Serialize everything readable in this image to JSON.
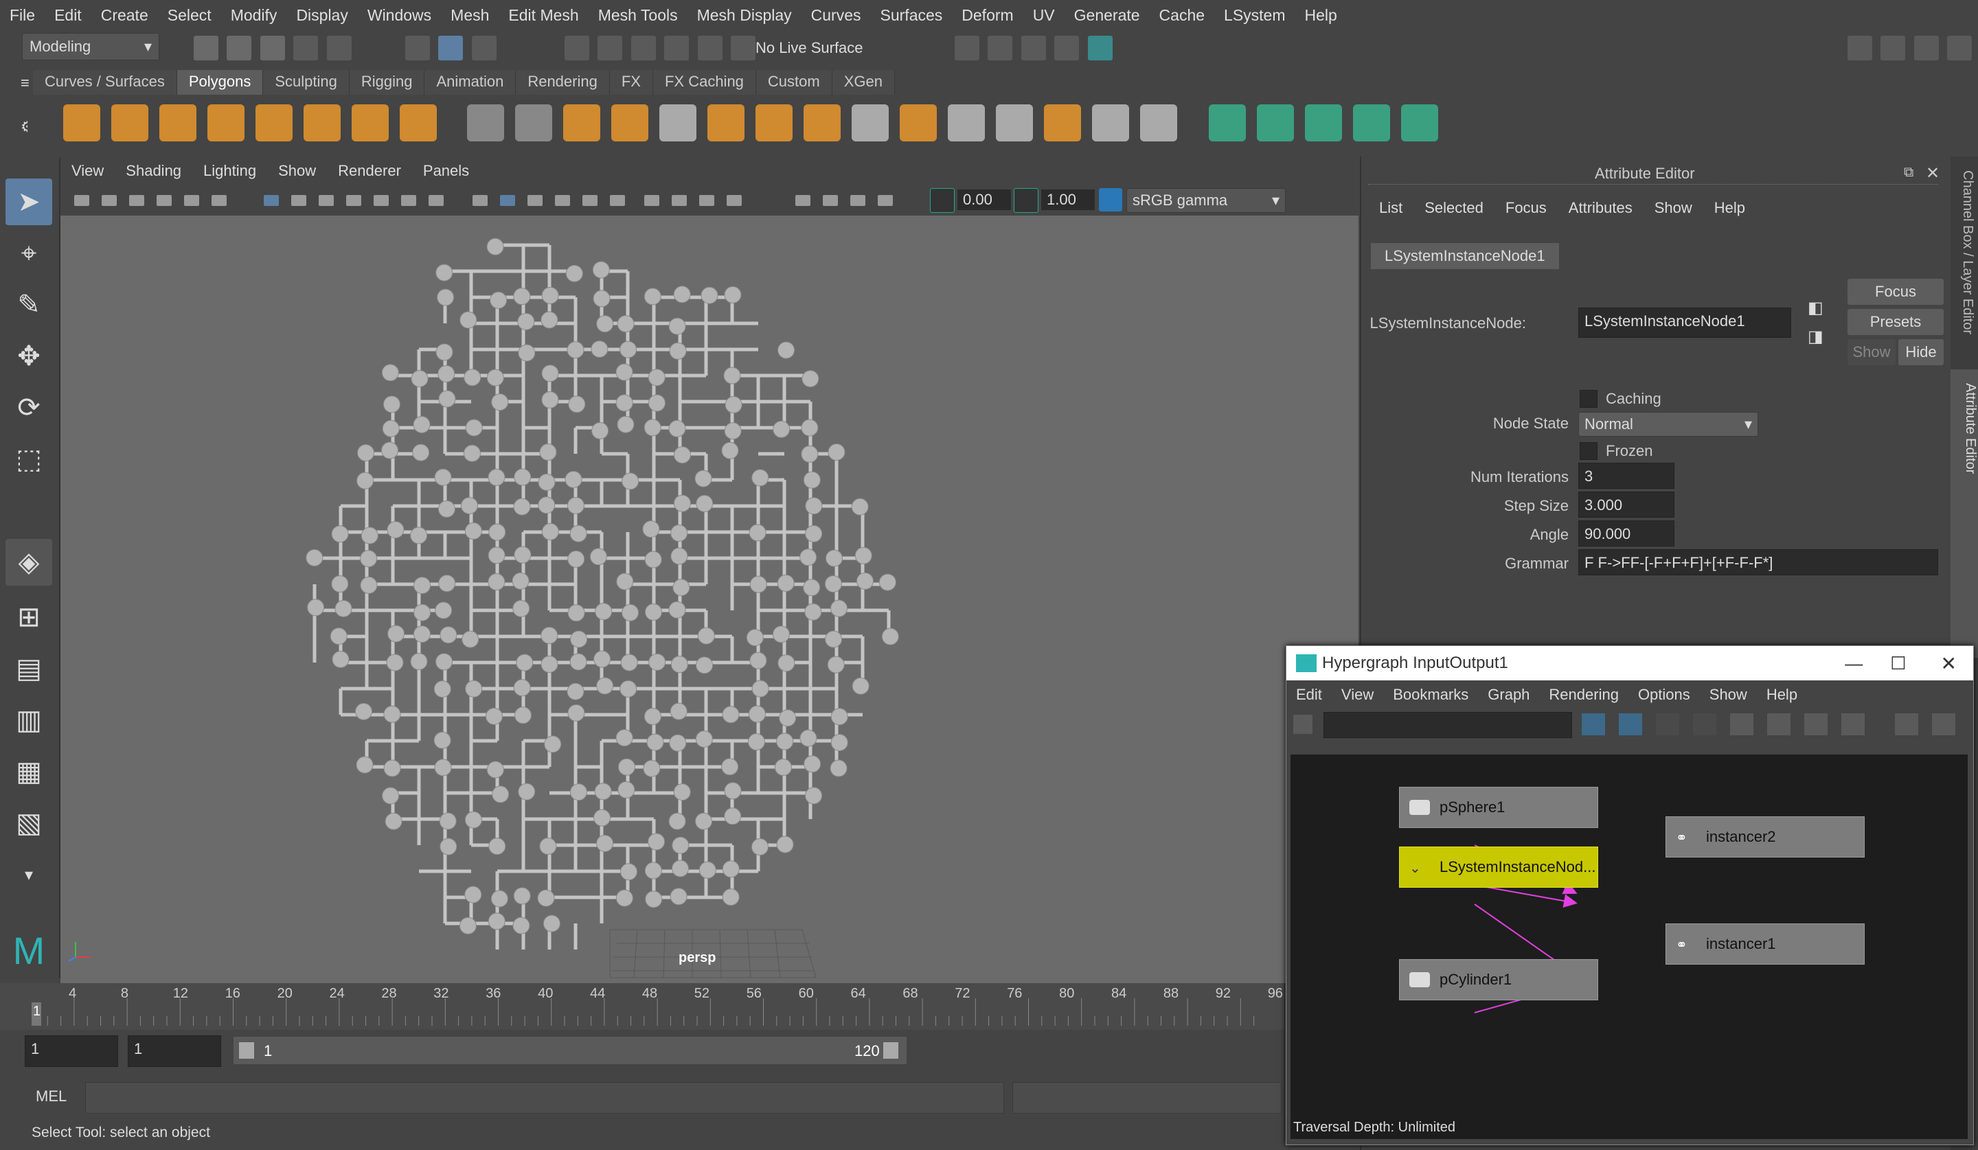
{
  "menubar": {
    "items": [
      "File",
      "Edit",
      "Create",
      "Select",
      "Modify",
      "Display",
      "Windows",
      "Mesh",
      "Edit Mesh",
      "Mesh Tools",
      "Mesh Display",
      "Curves",
      "Surfaces",
      "Deform",
      "UV",
      "Generate",
      "Cache",
      "LSystem",
      "Help"
    ]
  },
  "statusline": {
    "mode": "Modeling",
    "live_surface": "No Live Surface"
  },
  "shelf": {
    "tabs": [
      "Curves / Surfaces",
      "Polygons",
      "Sculpting",
      "Rigging",
      "Animation",
      "Rendering",
      "FX",
      "FX Caching",
      "Custom",
      "XGen"
    ],
    "active_tab": "Polygons"
  },
  "viewport": {
    "menu": [
      "View",
      "Shading",
      "Lighting",
      "Show",
      "Renderer",
      "Panels"
    ],
    "exposure": "0.00",
    "gamma": "1.00",
    "color_space": "sRGB gamma",
    "camera_label": "persp"
  },
  "timeline": {
    "ticks": [
      "4",
      "8",
      "12",
      "16",
      "20",
      "24",
      "28",
      "32",
      "36",
      "40",
      "44",
      "48",
      "52",
      "56",
      "60",
      "64",
      "68",
      "72",
      "76",
      "80",
      "84",
      "88",
      "92",
      "96"
    ],
    "current_frame": "1"
  },
  "range": {
    "start": "1",
    "playback_start": "1",
    "range_start": "1",
    "range_end": "120"
  },
  "command": {
    "language": "MEL"
  },
  "help_line": "Select Tool: select an object",
  "attribute_editor": {
    "title": "Attribute Editor",
    "menu": [
      "List",
      "Selected",
      "Focus",
      "Attributes",
      "Show",
      "Help"
    ],
    "node_tab": "LSystemInstanceNode1",
    "node_label": "LSystemInstanceNode:",
    "node_value": "LSystemInstanceNode1",
    "buttons": {
      "focus": "Focus",
      "presets": "Presets",
      "show": "Show",
      "hide": "Hide"
    },
    "caching_label": "Caching",
    "node_state_label": "Node State",
    "node_state_value": "Normal",
    "frozen_label": "Frozen",
    "num_iterations_label": "Num Iterations",
    "num_iterations": "3",
    "step_size_label": "Step Size",
    "step_size": "3.000",
    "angle_label": "Angle",
    "angle": "90.000",
    "grammar_label": "Grammar",
    "grammar": "F F->FF-[-F+F+F]+[+F-F-F*]"
  },
  "side_tabs": {
    "channel_box": "Channel Box / Layer Editor",
    "attribute_editor": "Attribute Editor"
  },
  "hypergraph": {
    "title": "Hypergraph InputOutput1",
    "menu": [
      "Edit",
      "View",
      "Bookmarks",
      "Graph",
      "Rendering",
      "Options",
      "Show",
      "Help"
    ],
    "nodes": {
      "psphere": "pSphere1",
      "lsystem": "LSystemInstanceNod...",
      "pcylinder": "pCylinder1",
      "instancer2": "instancer2",
      "instancer1": "instancer1"
    },
    "status": "Traversal Depth: Unlimited",
    "colors": {
      "selected_node": "#c8c800",
      "connection": "#e040e0"
    }
  }
}
